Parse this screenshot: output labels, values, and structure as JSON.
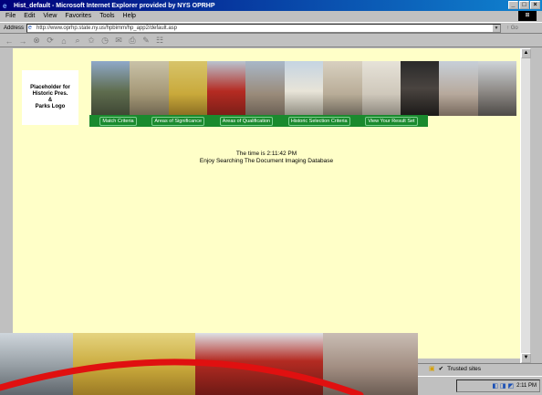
{
  "window": {
    "title": "Hist_default - Microsoft Internet Explorer provided by NYS OPRHP",
    "buttons": [
      "_",
      "□",
      "×"
    ]
  },
  "menu": {
    "items": [
      "File",
      "Edit",
      "View",
      "Favorites",
      "Tools",
      "Help"
    ]
  },
  "address": {
    "label": "Address",
    "url": "http://www.oprhp.state.ny.us/hpbimm/hp_app2/default.asp",
    "go_label": "Go"
  },
  "page": {
    "logo_line1": "Placeholder for",
    "logo_line2": "Historic Pres.",
    "logo_line3": "&",
    "logo_line4": "Parks Logo",
    "nav": [
      "Match Criteria",
      "Areas of Significance",
      "Areas of Qualification",
      "Historic Selection Criteria",
      "View Your Result Set"
    ],
    "time_line": "The time is 2:11:42 PM",
    "welcome_line": "Enjoy Searching The Document Imaging Database"
  },
  "status": {
    "zone": "Trusted sites"
  },
  "taskbar": {
    "clock": "2:11 PM"
  },
  "colors": {
    "page_bg": "#ffffc8",
    "nav_green": "#1a8a2e",
    "title_blue": "#00007b",
    "arc_red": "#e01010"
  }
}
